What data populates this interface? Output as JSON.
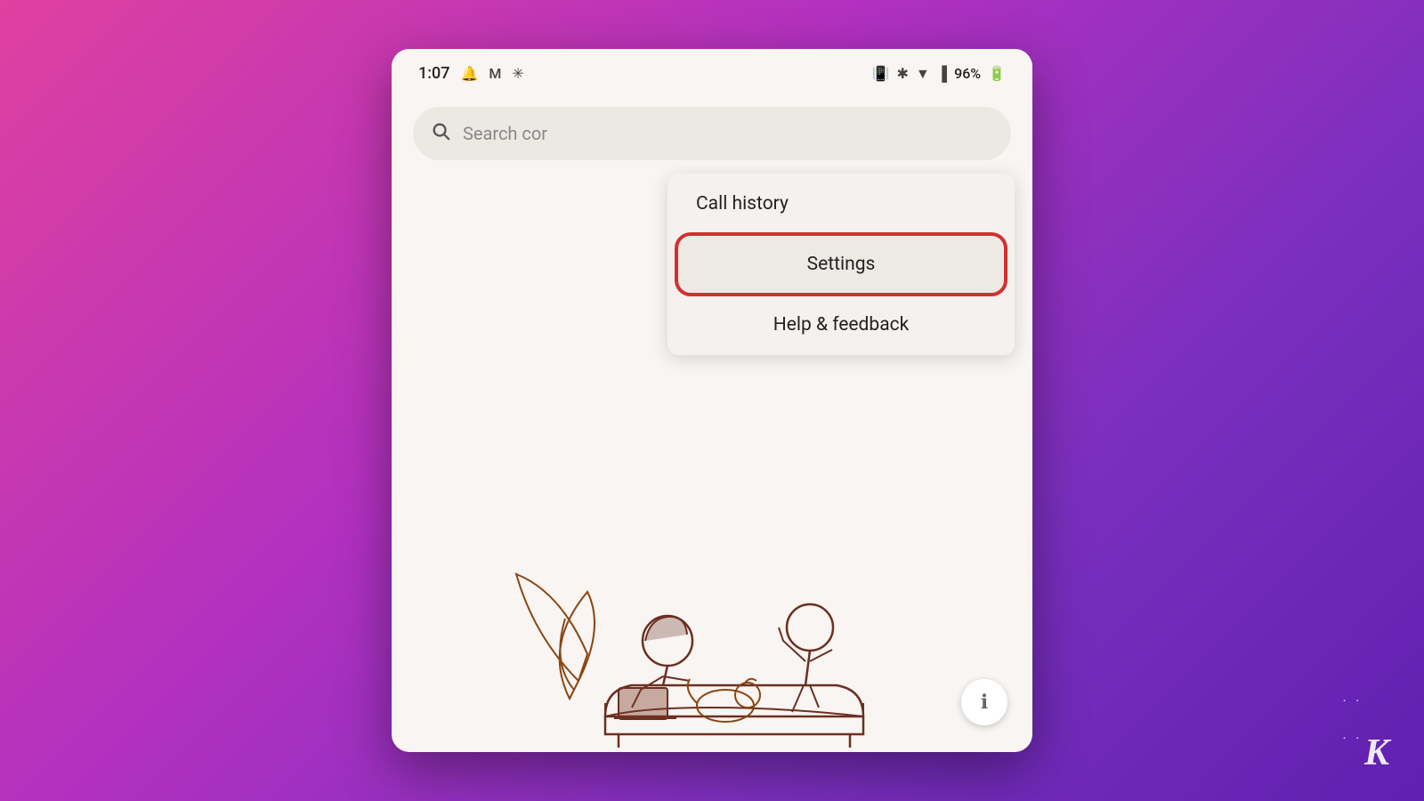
{
  "background": {
    "gradient_start": "#e040a0",
    "gradient_end": "#6020b0"
  },
  "status_bar": {
    "time": "1:07",
    "icons": [
      "notification-bell",
      "gmail",
      "asterisk"
    ],
    "right_icons": [
      "vibrate",
      "bluetooth",
      "wifi",
      "signal",
      "battery"
    ],
    "battery_percent": "96%"
  },
  "search": {
    "placeholder": "Search cor"
  },
  "dropdown": {
    "items": [
      {
        "label": "Call history",
        "highlighted": false
      },
      {
        "label": "Settings",
        "highlighted": true
      },
      {
        "label": "Help & feedback",
        "highlighted": false
      }
    ]
  },
  "info_button": {
    "symbol": "ℹ"
  },
  "logo": {
    "dots": "· ·",
    "text": "K"
  }
}
